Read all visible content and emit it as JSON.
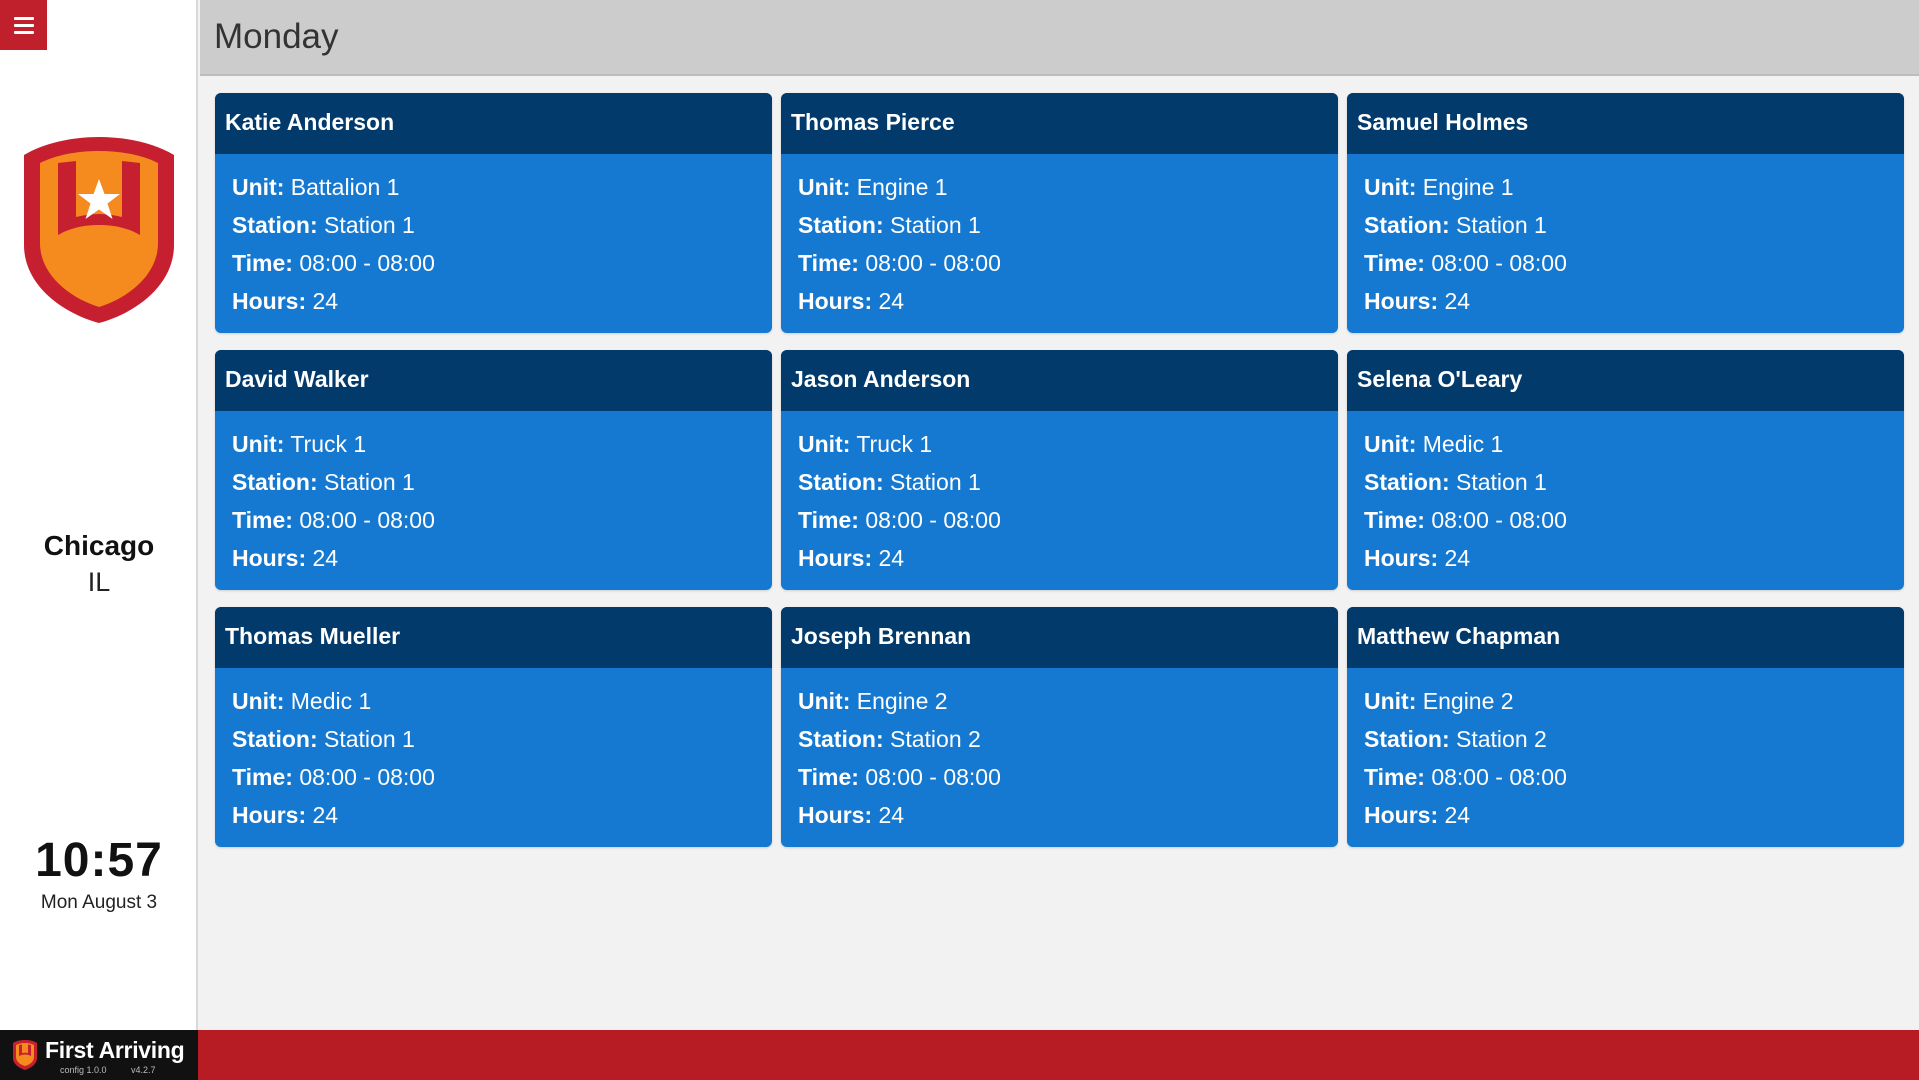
{
  "app": {
    "brand_name": "First Arriving",
    "config_version": "config 1.0.0",
    "app_version": "v4.2.7",
    "accent_color": "#c0202b",
    "footer_color": "#b71c24"
  },
  "sidebar": {
    "menu_icon": "hamburger-menu-icon",
    "logo_icon": "shield-star-icon",
    "city": "Chicago",
    "state": "IL",
    "clock": "10:57",
    "date": "Mon August 3"
  },
  "header": {
    "title": "Monday"
  },
  "labels": {
    "unit": "Unit:",
    "station": "Station:",
    "time": "Time:",
    "hours": "Hours:"
  },
  "card_colors": {
    "header": "#013a6b",
    "body": "#1578d1"
  },
  "shifts": [
    {
      "name": "Katie Anderson",
      "unit": "Battalion 1",
      "station": "Station 1",
      "time": "08:00 - 08:00",
      "hours": "24"
    },
    {
      "name": "Thomas Pierce",
      "unit": "Engine 1",
      "station": "Station 1",
      "time": "08:00 - 08:00",
      "hours": "24"
    },
    {
      "name": "Samuel Holmes",
      "unit": "Engine 1",
      "station": "Station 1",
      "time": "08:00 - 08:00",
      "hours": "24"
    },
    {
      "name": "David Walker",
      "unit": "Truck 1",
      "station": "Station 1",
      "time": "08:00 - 08:00",
      "hours": "24"
    },
    {
      "name": "Jason Anderson",
      "unit": "Truck 1",
      "station": "Station 1",
      "time": "08:00 - 08:00",
      "hours": "24"
    },
    {
      "name": "Selena O'Leary",
      "unit": "Medic 1",
      "station": "Station 1",
      "time": "08:00 - 08:00",
      "hours": "24"
    },
    {
      "name": "Thomas Mueller",
      "unit": "Medic 1",
      "station": "Station 1",
      "time": "08:00 - 08:00",
      "hours": "24"
    },
    {
      "name": "Joseph Brennan",
      "unit": "Engine 2",
      "station": "Station 2",
      "time": "08:00 - 08:00",
      "hours": "24"
    },
    {
      "name": "Matthew Chapman",
      "unit": "Engine 2",
      "station": "Station 2",
      "time": "08:00 - 08:00",
      "hours": "24"
    }
  ]
}
